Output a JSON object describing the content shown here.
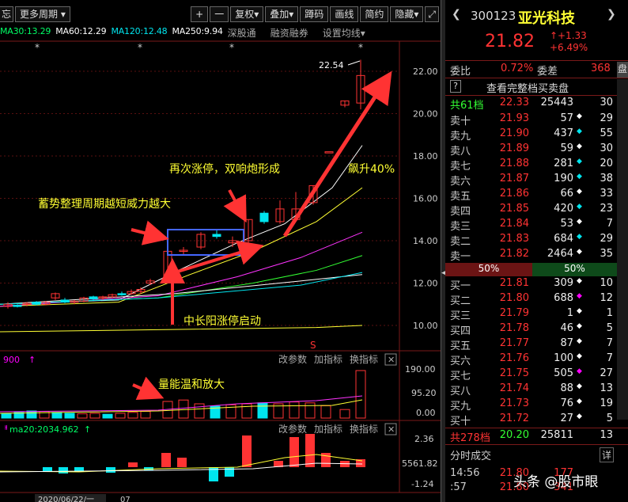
{
  "toolbar": {
    "partial": "忘",
    "period_label": "更多周期",
    "plus": "+",
    "minus": "一",
    "fq": "复权",
    "overlay": "叠加",
    "code": "蹲码",
    "draw": "画线",
    "simple": "简约",
    "hide": "隐藏",
    "expand_icon": "expand-icon",
    "close_icon": "close-icon"
  },
  "ma_line": {
    "ma30": "MA30:13.29",
    "ma60": "MA60:12.29",
    "ma120": "MA120:12.48",
    "ma250": "MA250:9.94",
    "menu1": "深股通",
    "menu2": "融资融券",
    "menu3": "设置均线"
  },
  "main_chart": {
    "high_label": "22.54",
    "stars": [
      "*",
      "*",
      "*",
      "*"
    ],
    "s_marker": "S",
    "y_ticks": [
      "22.00",
      "20.00",
      "18.00",
      "16.00",
      "14.00",
      "12.00",
      "10.00"
    ]
  },
  "annotations": {
    "a1": "再次涨停，双响炮形成",
    "a2": "飙升40%",
    "a3": "蓄势整理周期越短威力越大",
    "a4": "中长阳涨停启动",
    "a5": "量能温和放大"
  },
  "vol_panel": {
    "header_left": "900",
    "menu1": "改参数",
    "menu2": "加指标",
    "menu3": "换指标",
    "y_ticks": [
      "190.00",
      "95.20",
      "0.00"
    ]
  },
  "macd_panel": {
    "header_left": "ma20:2034.962",
    "menu1": "改参数",
    "menu2": "加指标",
    "menu3": "换指标",
    "y_ticks": [
      "2.36",
      "5561.82",
      "-1.24"
    ]
  },
  "date_bar": {
    "date": "2020/06/22/一",
    "next": "07"
  },
  "quote": {
    "code": "300123",
    "name": "亚光科技",
    "price": "21.82",
    "change": "+1.33",
    "change_pct": "+6.49%",
    "weibi_label": "委比",
    "weibi": "0.72%",
    "weicha_label": "委差",
    "weicha": "368",
    "pan_tab": "盘",
    "full_book": "查看完整档买卖盘",
    "help": "?",
    "sell_total_label": "共61档",
    "sell_total_price": "22.33",
    "sell_total_vol": "25443",
    "sell_total_cnt": "30",
    "sells": [
      {
        "label": "卖十",
        "price": "21.93",
        "vol": "57",
        "dot": "◆",
        "dotc": "white",
        "cnt": "29"
      },
      {
        "label": "卖九",
        "price": "21.90",
        "vol": "437",
        "dot": "◆",
        "dotc": "cyan",
        "cnt": "55"
      },
      {
        "label": "卖八",
        "price": "21.89",
        "vol": "59",
        "dot": "◆",
        "dotc": "white",
        "cnt": "30"
      },
      {
        "label": "卖七",
        "price": "21.88",
        "vol": "281",
        "dot": "◆",
        "dotc": "cyan",
        "cnt": "20"
      },
      {
        "label": "卖六",
        "price": "21.87",
        "vol": "190",
        "dot": "◆",
        "dotc": "cyan",
        "cnt": "38"
      },
      {
        "label": "卖五",
        "price": "21.86",
        "vol": "66",
        "dot": "◆",
        "dotc": "white",
        "cnt": "33"
      },
      {
        "label": "卖四",
        "price": "21.85",
        "vol": "420",
        "dot": "◆",
        "dotc": "cyan",
        "cnt": "23"
      },
      {
        "label": "卖三",
        "price": "21.84",
        "vol": "53",
        "dot": "◆",
        "dotc": "white",
        "cnt": "7"
      },
      {
        "label": "卖二",
        "price": "21.83",
        "vol": "684",
        "dot": "◆",
        "dotc": "cyan",
        "cnt": "29"
      },
      {
        "label": "卖一",
        "price": "21.82",
        "vol": "2464",
        "dot": "◆",
        "dotc": "white",
        "cnt": "35"
      }
    ],
    "pct_left": "50%",
    "pct_right": "50%",
    "buys": [
      {
        "label": "买一",
        "price": "21.81",
        "vol": "309",
        "dot": "◆",
        "dotc": "white",
        "cnt": "10"
      },
      {
        "label": "买二",
        "price": "21.80",
        "vol": "688",
        "dot": "◆",
        "dotc": "mag",
        "cnt": "12"
      },
      {
        "label": "买三",
        "price": "21.79",
        "vol": "1",
        "dot": "◆",
        "dotc": "white",
        "cnt": "1"
      },
      {
        "label": "买四",
        "price": "21.78",
        "vol": "46",
        "dot": "◆",
        "dotc": "white",
        "cnt": "5"
      },
      {
        "label": "买五",
        "price": "21.77",
        "vol": "87",
        "dot": "◆",
        "dotc": "white",
        "cnt": "7"
      },
      {
        "label": "买六",
        "price": "21.76",
        "vol": "100",
        "dot": "◆",
        "dotc": "white",
        "cnt": "7"
      },
      {
        "label": "买七",
        "price": "21.75",
        "vol": "505",
        "dot": "◆",
        "dotc": "mag",
        "cnt": "27"
      },
      {
        "label": "买八",
        "price": "21.74",
        "vol": "88",
        "dot": "◆",
        "dotc": "white",
        "cnt": "13"
      },
      {
        "label": "买九",
        "price": "21.73",
        "vol": "76",
        "dot": "◆",
        "dotc": "white",
        "cnt": "19"
      },
      {
        "label": "买十",
        "price": "21.72",
        "vol": "27",
        "dot": "◆",
        "dotc": "white",
        "cnt": "5"
      }
    ],
    "buy_total_label": "共278档",
    "buy_total_price": "20.20",
    "buy_total_vol": "25811",
    "buy_total_cnt": "13",
    "ticks_title": "分时成交",
    "ticks_btn": "详",
    "ticks": [
      {
        "time": "14:56",
        "price": "21.80",
        "vol": "177"
      },
      {
        "time": ":57",
        "price": "21.80",
        "vol": "341"
      }
    ],
    "watermark": "头条 @股市眼"
  },
  "colors": {
    "up": "#ff3333",
    "down": "#00e5ee",
    "bg": "#000000",
    "grid": "#7a1a1a"
  }
}
